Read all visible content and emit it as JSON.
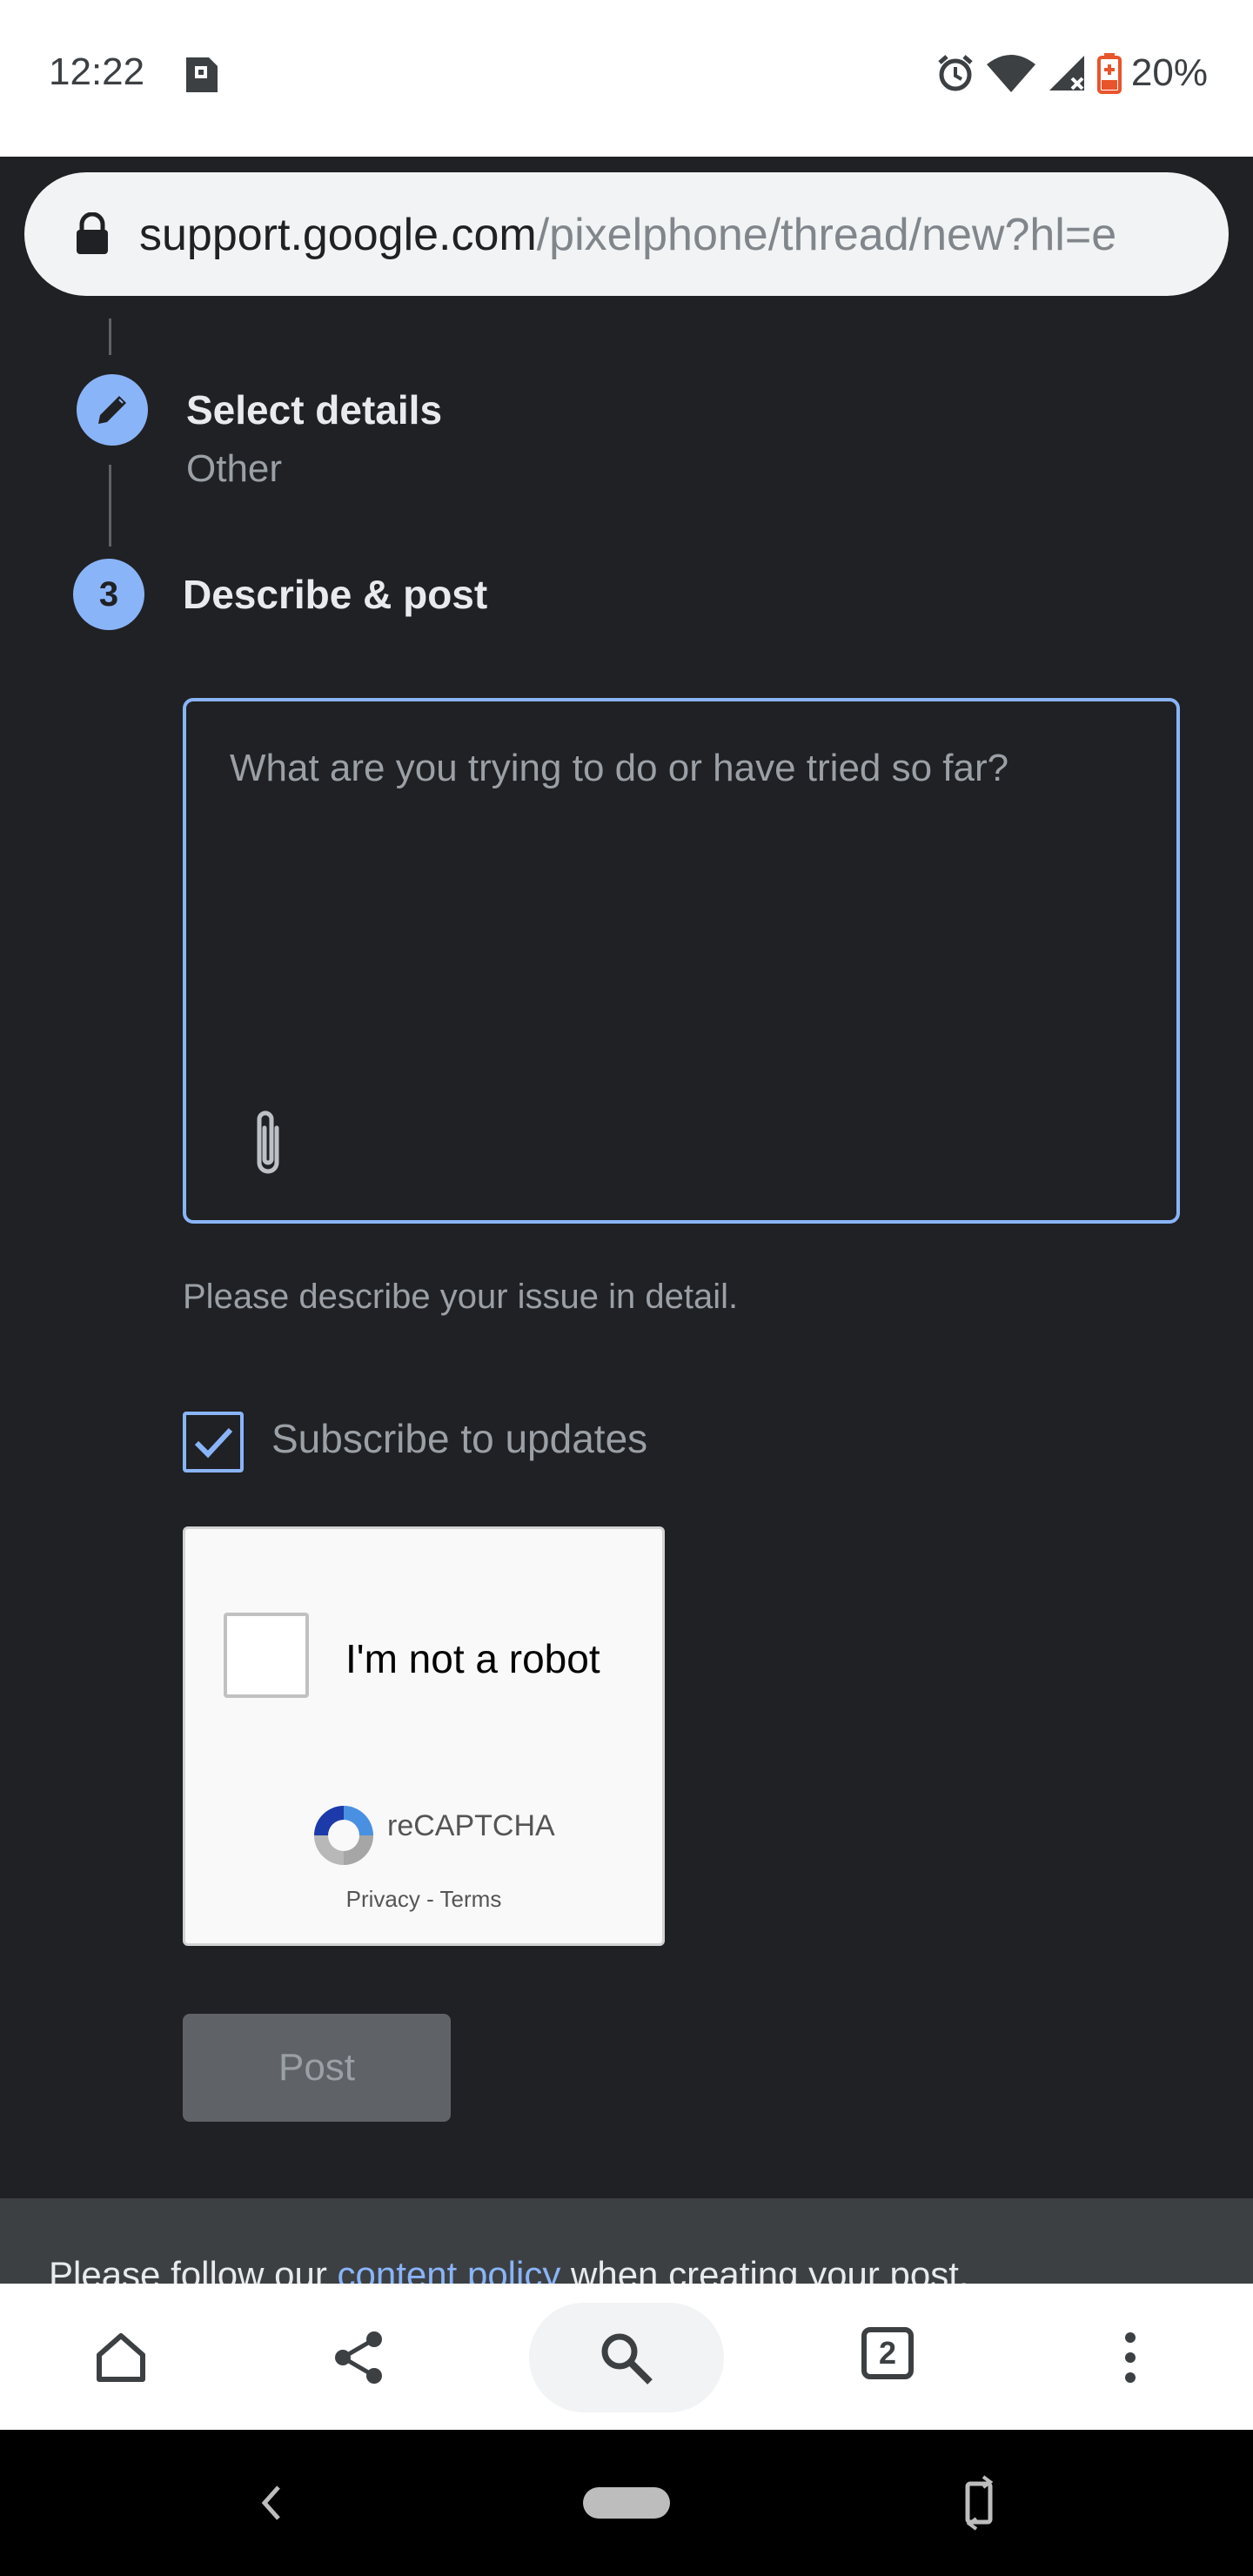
{
  "status_bar": {
    "time": "12:22",
    "battery": "20%",
    "icons": [
      "sd-card-icon",
      "alarm-icon",
      "wifi-icon",
      "cell-signal-icon",
      "battery-icon"
    ]
  },
  "url_bar": {
    "domain": "support.google.com",
    "path": "/pixelphone/thread/new?hl=e"
  },
  "steps": [
    {
      "icon": "pencil-icon",
      "title": "Select details",
      "subtitle": "Other"
    },
    {
      "number": "3",
      "title": "Describe & post"
    }
  ],
  "editor": {
    "placeholder": "What are you trying to do or have tried so far?",
    "hint": "Please describe your issue in detail."
  },
  "subscribe": {
    "label": "Subscribe to updates",
    "checked": true
  },
  "captcha": {
    "label": "I'm not a robot",
    "brand": "reCAPTCHA",
    "privacy": "Privacy",
    "separator": " - ",
    "terms": "Terms"
  },
  "post_button": {
    "label": "Post"
  },
  "footer": {
    "before": "Please follow our ",
    "link": "content policy",
    "after": " when creating your post."
  },
  "toolbar": {
    "tab_count": "2"
  },
  "colors": {
    "accent": "#8ab4f8",
    "page_bg": "#202124",
    "battery": "#e8542b"
  }
}
